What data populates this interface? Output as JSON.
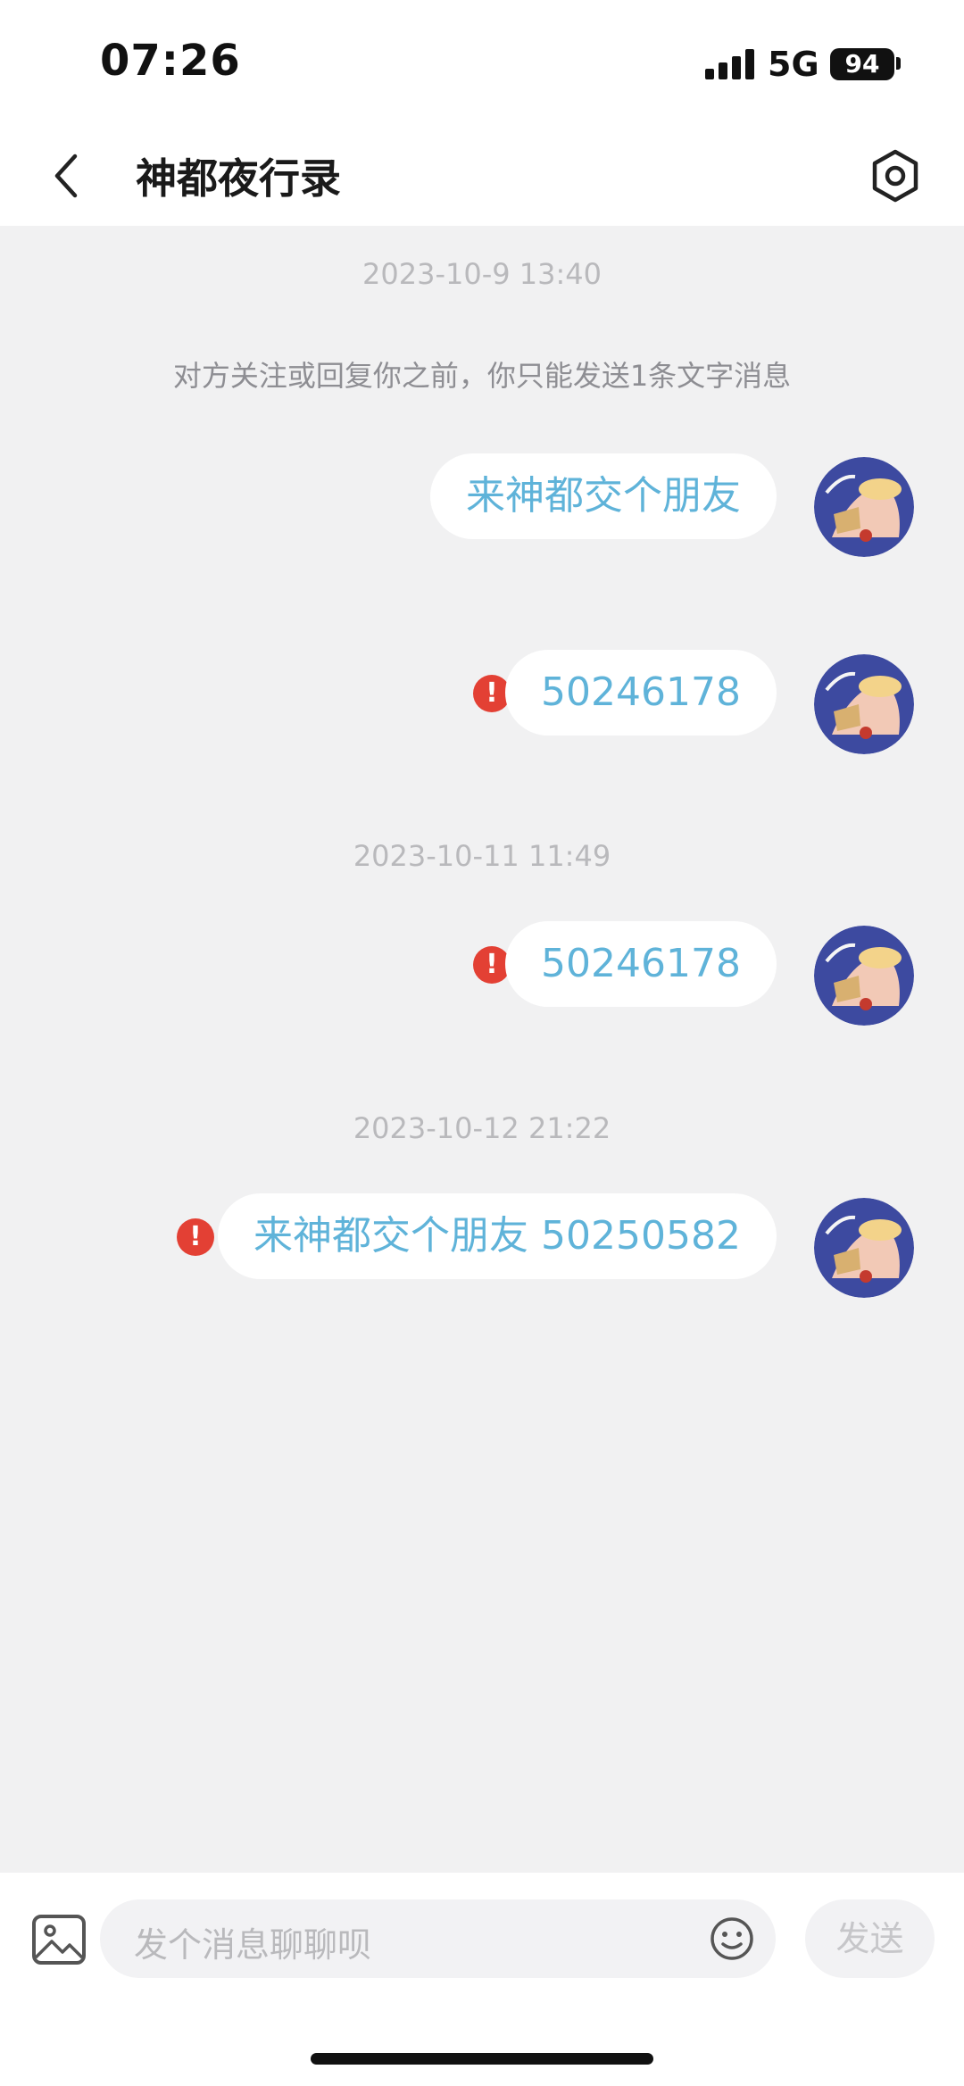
{
  "status_bar": {
    "time": "07:26",
    "network": "5G",
    "battery": "94"
  },
  "header": {
    "title": "神都夜行录",
    "back_icon": "chevron-left-icon",
    "settings_icon": "hexagon-settings-icon"
  },
  "chat": {
    "items": [
      {
        "type": "timestamp",
        "text": "2023-10-9 13:40"
      },
      {
        "type": "notice",
        "text": "对方关注或回复你之前，你只能发送1条文字消息"
      },
      {
        "type": "message",
        "text": "来神都交个朋友",
        "failed": false
      },
      {
        "type": "message",
        "text": "50246178",
        "failed": true
      },
      {
        "type": "timestamp",
        "text": "2023-10-11 11:49"
      },
      {
        "type": "message",
        "text": "50246178",
        "failed": true
      },
      {
        "type": "timestamp",
        "text": "2023-10-12 21:22"
      },
      {
        "type": "message",
        "text": "来神都交个朋友 50250582",
        "failed": true
      }
    ],
    "error_glyph": "!"
  },
  "input_bar": {
    "placeholder": "发个消息聊聊呗",
    "send_label": "发送",
    "image_icon": "image-icon",
    "emoji_icon": "emoji-icon"
  },
  "colors": {
    "background": "#f1f1f2",
    "bubble_text": "#5fb3d9",
    "error": "#e34034",
    "timestamp": "#b9b9bc"
  }
}
